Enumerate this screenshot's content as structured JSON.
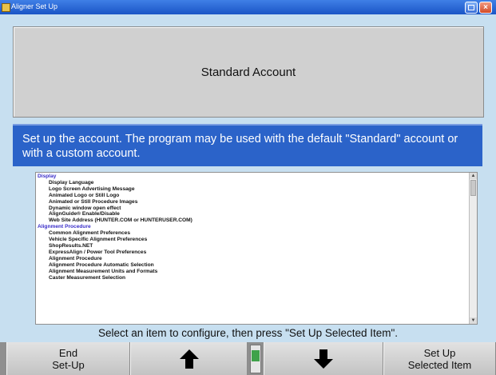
{
  "window": {
    "title": "Aligner Set Up",
    "icon": "app-icon"
  },
  "account": {
    "title": "Standard Account"
  },
  "instruction": {
    "text": "Set up the account.  The program may be used with the default \"Standard\" account or with a custom account."
  },
  "list": {
    "rows": [
      {
        "type": "category",
        "label": "Display"
      },
      {
        "type": "item",
        "label": "Display Language"
      },
      {
        "type": "item",
        "label": "Logo Screen Advertising Message"
      },
      {
        "type": "item",
        "label": "Animated Logo or Still Logo"
      },
      {
        "type": "item",
        "label": "Animated or Still Procedure Images"
      },
      {
        "type": "item",
        "label": "Dynamic window open effect"
      },
      {
        "type": "item",
        "label": "AlignGuide® Enable/Disable"
      },
      {
        "type": "item",
        "label": "Web Site Address (HUNTER.COM or HUNTERUSER.COM)"
      },
      {
        "type": "category",
        "label": "Alignment Procedure"
      },
      {
        "type": "item",
        "label": "Common Alignment Preferences"
      },
      {
        "type": "item",
        "label": "Vehicle Specific Alignment Preferences"
      },
      {
        "type": "item",
        "label": "ShopResults.NET"
      },
      {
        "type": "item",
        "label": "ExpressAlign / Power Tool Preferences"
      },
      {
        "type": "item",
        "label": "Alignment Procedure"
      },
      {
        "type": "item",
        "label": "Alignment Procedure Automatic Selection"
      },
      {
        "type": "item",
        "label": "Alignment Measurement Units and Formats"
      },
      {
        "type": "item",
        "label": "Caster Measurement Selection"
      }
    ]
  },
  "hint": {
    "text": "Select an item to configure, then press \"Set Up Selected Item\"."
  },
  "softkeys": {
    "end_line1": "End",
    "end_line2": "Set-Up",
    "up_icon": "arrow-up-icon",
    "down_icon": "arrow-down-icon",
    "setup_line1": "Set Up",
    "setup_line2": "Selected Item"
  },
  "colors": {
    "title_bar": "#1a55c6",
    "instruction_bg": "#2b63c9",
    "category_text": "#3a2ec9",
    "indicator": "#3fa24a"
  }
}
